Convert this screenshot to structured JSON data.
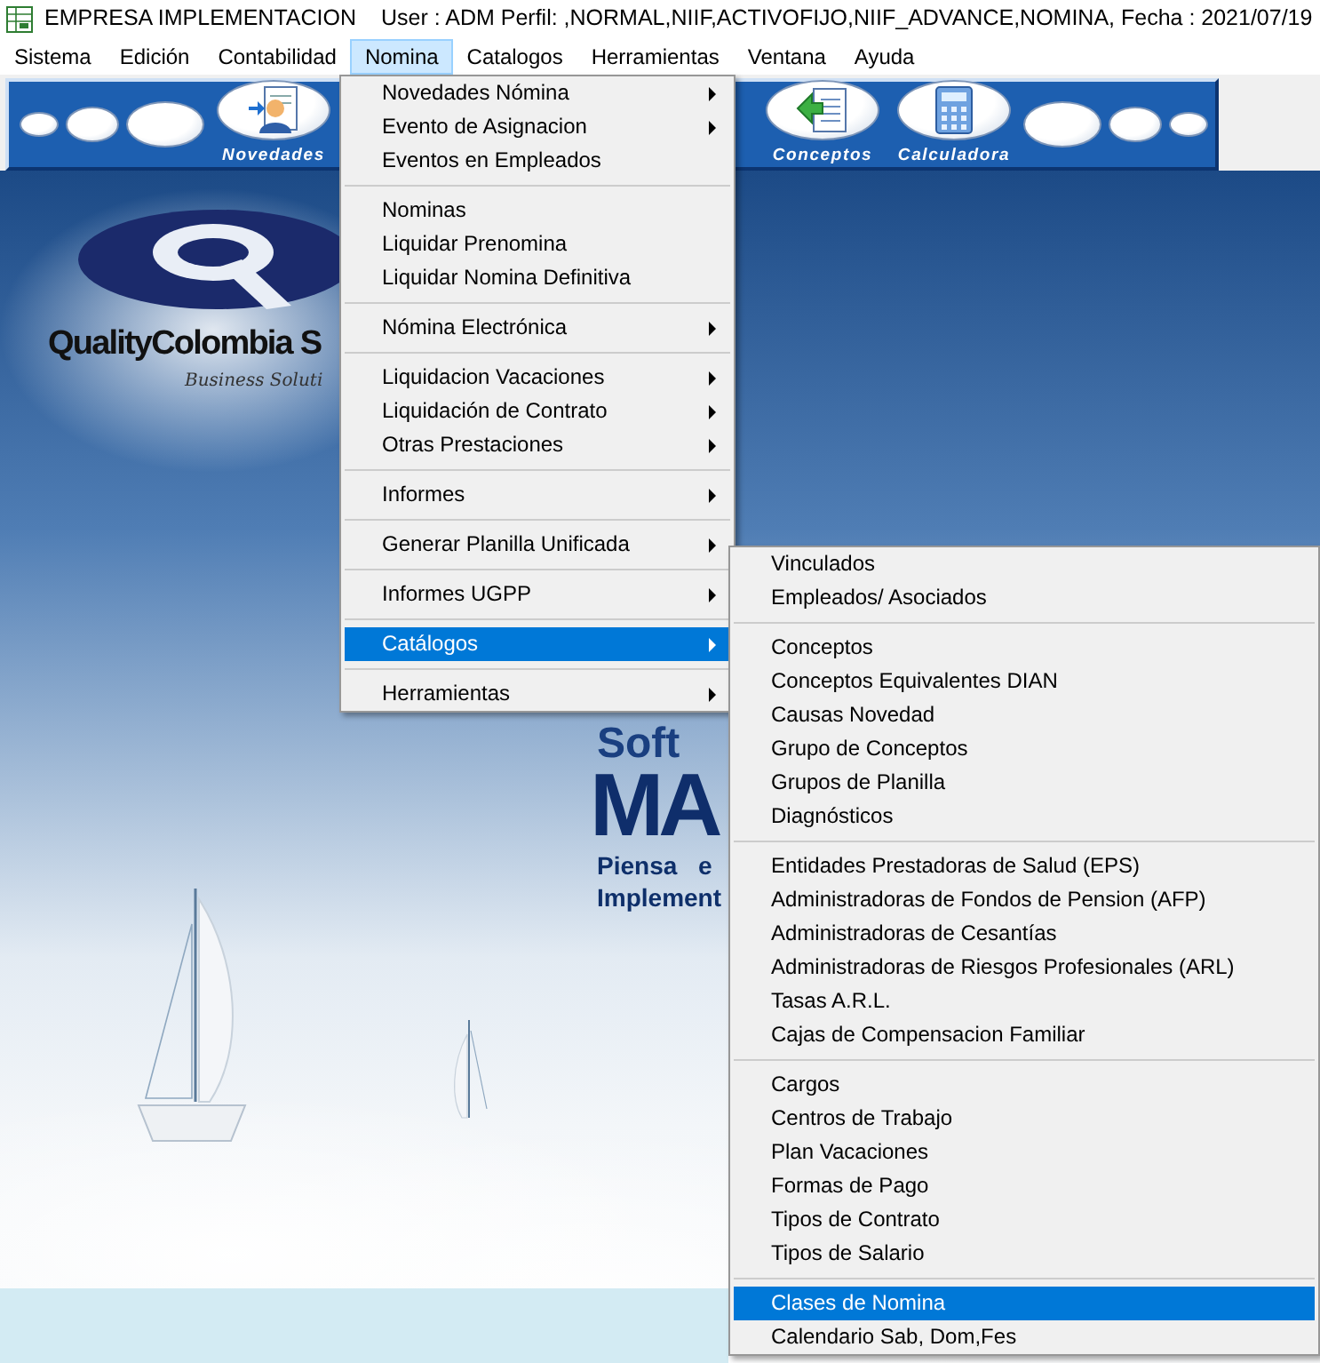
{
  "window": {
    "title": "EMPRESA IMPLEMENTACION",
    "session": "User : ADM Perfil: ,NORMAL,NIIF,ACTIVOFIJO,NIIF_ADVANCE,NOMINA, Fecha : 2021/07/19"
  },
  "menu_bar": [
    {
      "label": "Sistema",
      "selected": false
    },
    {
      "label": "Edición",
      "selected": false
    },
    {
      "label": "Contabilidad",
      "selected": false
    },
    {
      "label": "Nomina",
      "selected": true
    },
    {
      "label": "Catalogos",
      "selected": false
    },
    {
      "label": "Herramientas",
      "selected": false
    },
    {
      "label": "Ventana",
      "selected": false
    },
    {
      "label": "Ayuda",
      "selected": false
    }
  ],
  "toolbar": {
    "left": [
      {
        "kind": "dot"
      },
      {
        "kind": "ellipse"
      },
      {
        "kind": "oval"
      },
      {
        "kind": "person",
        "label": "Novedades"
      }
    ],
    "right": [
      {
        "kind": "arrow",
        "label": "Conceptos"
      },
      {
        "kind": "calculator",
        "label": "Calculadora"
      },
      {
        "kind": "oval"
      },
      {
        "kind": "ellipse"
      },
      {
        "kind": "dot"
      }
    ]
  },
  "wallpaper": {
    "brand": "QualityColombia S",
    "tagline": "Business Soluti",
    "product_top": "Soft",
    "product_bottom": "MA",
    "slogan_1": "Piensa e",
    "slogan_2": "Implement"
  },
  "nomina_menu": {
    "groups": [
      [
        {
          "label": "Novedades Nómina",
          "submenu": true,
          "selected": false
        },
        {
          "label": "Evento de Asignacion",
          "submenu": true,
          "selected": false
        },
        {
          "label": "Eventos en Empleados",
          "submenu": false,
          "selected": false
        }
      ],
      [
        {
          "label": "Nominas",
          "submenu": false,
          "selected": false
        },
        {
          "label": "Liquidar Prenomina",
          "submenu": false,
          "selected": false
        },
        {
          "label": "Liquidar Nomina Definitiva",
          "submenu": false,
          "selected": false
        }
      ],
      [
        {
          "label": "Nómina Electrónica",
          "submenu": true,
          "selected": false
        }
      ],
      [
        {
          "label": "Liquidacion Vacaciones",
          "submenu": true,
          "selected": false
        },
        {
          "label": "Liquidación de Contrato",
          "submenu": true,
          "selected": false
        },
        {
          "label": "Otras Prestaciones",
          "submenu": true,
          "selected": false
        }
      ],
      [
        {
          "label": "Informes",
          "submenu": true,
          "selected": false
        }
      ],
      [
        {
          "label": "Generar Planilla Unificada",
          "submenu": true,
          "selected": false
        }
      ],
      [
        {
          "label": "Informes UGPP",
          "submenu": true,
          "selected": false
        }
      ],
      [
        {
          "label": "Catálogos",
          "submenu": true,
          "selected": true
        }
      ],
      [
        {
          "label": "Herramientas",
          "submenu": true,
          "selected": false
        }
      ]
    ]
  },
  "catalogos_submenu": {
    "groups": [
      [
        {
          "label": "Vinculados",
          "selected": false
        },
        {
          "label": "Empleados/ Asociados",
          "selected": false
        }
      ],
      [
        {
          "label": "Conceptos",
          "selected": false
        },
        {
          "label": "Conceptos Equivalentes DIAN",
          "selected": false
        },
        {
          "label": "Causas Novedad",
          "selected": false
        },
        {
          "label": "Grupo de Conceptos",
          "selected": false
        },
        {
          "label": "Grupos de Planilla",
          "selected": false
        },
        {
          "label": "Diagnósticos",
          "selected": false
        }
      ],
      [
        {
          "label": "Entidades Prestadoras de Salud (EPS)",
          "selected": false
        },
        {
          "label": "Administradoras de Fondos de Pension (AFP)",
          "selected": false
        },
        {
          "label": "Administradoras de Cesantías",
          "selected": false
        },
        {
          "label": "Administradoras de Riesgos Profesionales (ARL)",
          "selected": false
        },
        {
          "label": "Tasas A.R.L.",
          "selected": false
        },
        {
          "label": "Cajas de Compensacion Familiar",
          "selected": false
        }
      ],
      [
        {
          "label": "Cargos",
          "selected": false
        },
        {
          "label": "Centros de Trabajo",
          "selected": false
        },
        {
          "label": "Plan Vacaciones",
          "selected": false
        },
        {
          "label": "Formas de Pago",
          "selected": false
        },
        {
          "label": "Tipos de Contrato",
          "selected": false
        },
        {
          "label": "Tipos de Salario",
          "selected": false
        }
      ],
      [
        {
          "label": "Clases de Nomina",
          "selected": true
        },
        {
          "label": "Calendario Sab, Dom,Fes",
          "selected": false
        }
      ]
    ]
  }
}
